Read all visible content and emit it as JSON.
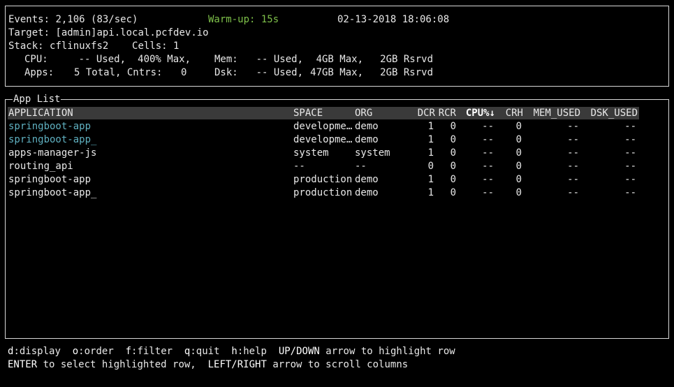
{
  "header": {
    "events_label": "Events:",
    "events_value": "2,106 (83/sec)",
    "warmup": "Warm-up: 15s",
    "datetime": "02-13-2018 18:06:08",
    "target_label": "Target:",
    "target_value": "[admin]api.local.pcfdev.io",
    "stack_label": "Stack:",
    "stack_value": "cflinuxfs2",
    "cells_label": "Cells:",
    "cells_value": "1",
    "cpu_label": "CPU:",
    "cpu_used": "-- Used,",
    "cpu_max": "400% Max,",
    "mem_label": "Mem:",
    "mem_used": "-- Used,",
    "mem_max": "4GB Max,",
    "mem_rsrvd": "2GB Rsrvd",
    "apps_label": "Apps:",
    "apps_total": "5 Total, Cntrs:",
    "apps_cntrs": "0",
    "dsk_label": "Dsk:",
    "dsk_used": "-- Used,",
    "dsk_max": "47GB Max,",
    "dsk_rsrvd": "2GB Rsrvd"
  },
  "app_list": {
    "title": "App List",
    "columns": [
      "APPLICATION",
      "SPACE",
      "ORG",
      "DCR",
      "RCR",
      "CPU%↓",
      "CRH",
      "MEM_USED",
      "DSK_USED"
    ],
    "rows": [
      {
        "application": "springboot-app",
        "space": "developme…",
        "org": "demo",
        "dcr": "1",
        "rcr": "0",
        "cpu": "--",
        "crh": "0",
        "mem": "--",
        "dsk": "--",
        "highlight": true
      },
      {
        "application": "springboot-app_",
        "space": "developme…",
        "org": "demo",
        "dcr": "1",
        "rcr": "0",
        "cpu": "--",
        "crh": "0",
        "mem": "--",
        "dsk": "--",
        "highlight": true
      },
      {
        "application": "apps-manager-js",
        "space": "system",
        "org": "system",
        "dcr": "1",
        "rcr": "0",
        "cpu": "--",
        "crh": "0",
        "mem": "--",
        "dsk": "--",
        "highlight": false
      },
      {
        "application": "routing_api",
        "space": "--",
        "org": "--",
        "dcr": "0",
        "rcr": "0",
        "cpu": "--",
        "crh": "0",
        "mem": "--",
        "dsk": "--",
        "highlight": false
      },
      {
        "application": "springboot-app",
        "space": "production",
        "org": "demo",
        "dcr": "1",
        "rcr": "0",
        "cpu": "--",
        "crh": "0",
        "mem": "--",
        "dsk": "--",
        "highlight": false
      },
      {
        "application": "springboot-app_",
        "space": "production",
        "org": "demo",
        "dcr": "1",
        "rcr": "0",
        "cpu": "--",
        "crh": "0",
        "mem": "--",
        "dsk": "--",
        "highlight": false
      }
    ]
  },
  "footer": {
    "line1": [
      {
        "key": "d",
        "desc": ":display"
      },
      {
        "key": "o",
        "desc": ":order"
      },
      {
        "key": "f",
        "desc": ":filter"
      },
      {
        "key": "q",
        "desc": ":quit"
      },
      {
        "key": "h",
        "desc": ":help"
      },
      {
        "key": "UP/DOWN",
        "desc": " arrow to highlight row"
      }
    ],
    "line2": [
      {
        "key": "ENTER",
        "desc": " to select highlighted row,"
      },
      {
        "key": "LEFT/RIGHT",
        "desc": " arrow to scroll columns"
      }
    ]
  },
  "colors": {
    "highlight_text": "#5fb0c0",
    "warmup": "#7ec04a",
    "header_bar": "#3a3a3a"
  }
}
